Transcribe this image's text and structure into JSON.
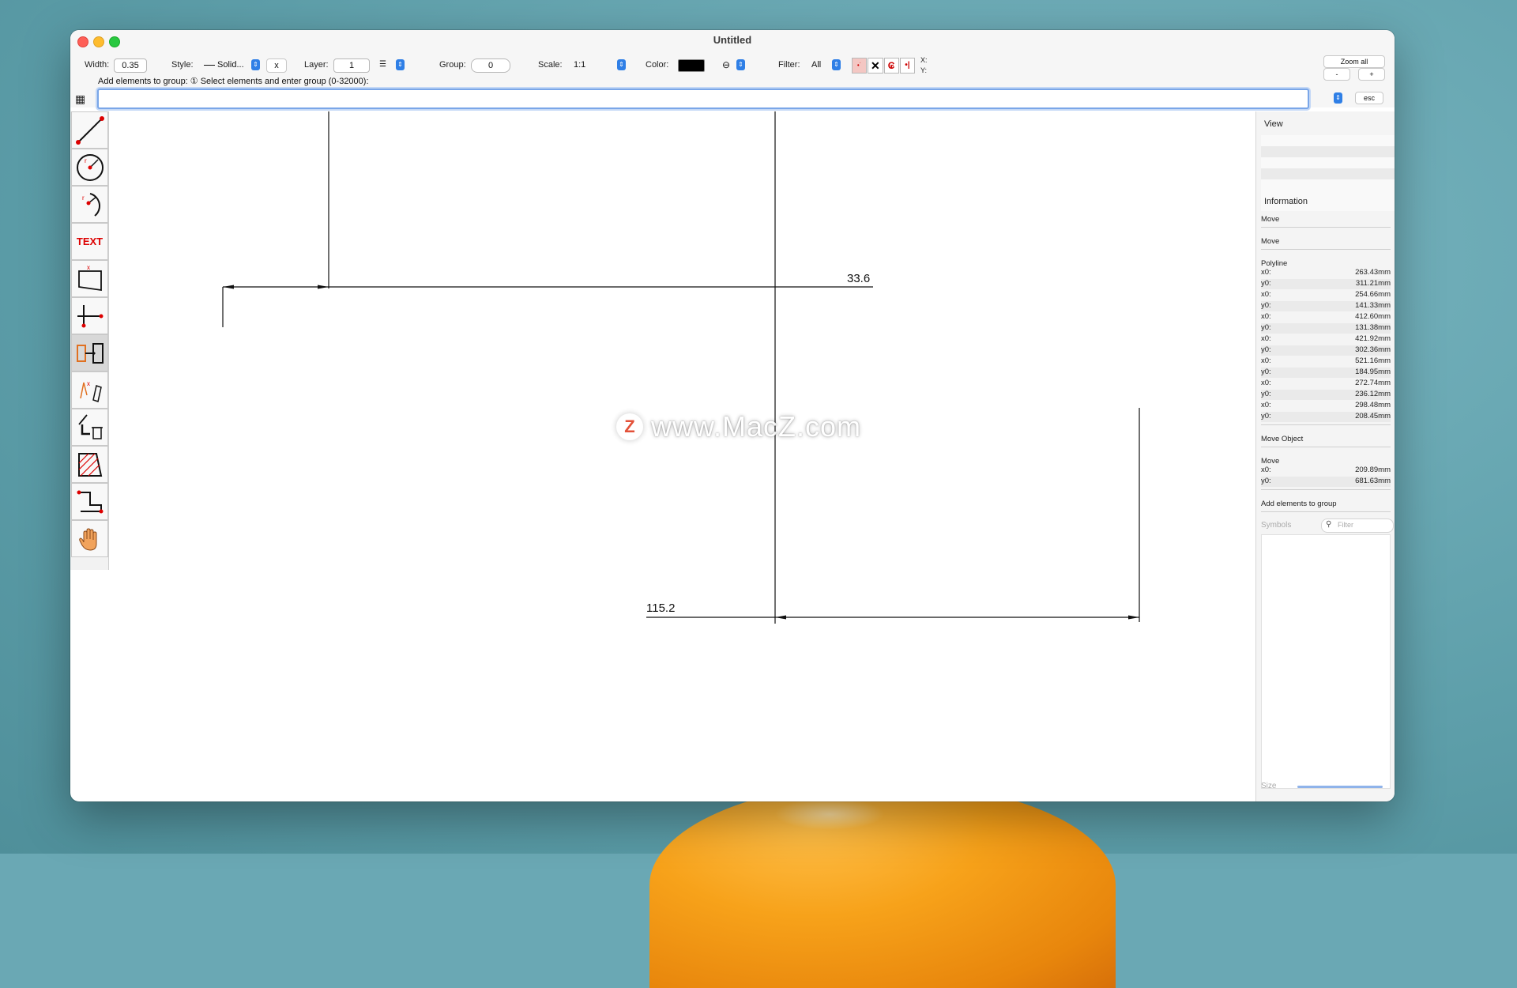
{
  "window": {
    "title": "Untitled"
  },
  "toolbar": {
    "width_label": "Width:",
    "width_value": "0.35",
    "style_label": "Style:",
    "style_value": "Solid...",
    "style_x": "x",
    "layer_label": "Layer:",
    "layer_value": "1",
    "group_label": "Group:",
    "group_value": "0",
    "scale_label": "Scale:",
    "scale_value": "1:1",
    "color_label": "Color:",
    "color_value": "#000000",
    "filter_label": "Filter:",
    "filter_value": "All",
    "coord_x": "X:",
    "coord_y": "Y:",
    "zoom_all": "Zoom all",
    "zoom_minus": "-",
    "zoom_plus": "+",
    "esc": "esc"
  },
  "hint": "Add elements to group: ① Select elements and enter group (0-32000):",
  "command_input": {
    "value": ""
  },
  "tools": [
    {
      "name": "line-tool",
      "icon": "line-icon"
    },
    {
      "name": "circle-tool",
      "icon": "circle-radius-icon"
    },
    {
      "name": "arc-tool",
      "icon": "arc-icon"
    },
    {
      "name": "text-tool",
      "icon": "text-icon",
      "label": "TEXT"
    },
    {
      "name": "dimension-tool",
      "icon": "dimension-icon"
    },
    {
      "name": "axis-tool",
      "icon": "axis-icon"
    },
    {
      "name": "move-tool",
      "icon": "move-copy-icon"
    },
    {
      "name": "transform-tool",
      "icon": "transform-icon"
    },
    {
      "name": "delete-tool",
      "icon": "trash-icon"
    },
    {
      "name": "hatch-tool",
      "icon": "hatch-icon"
    },
    {
      "name": "polyline-tool",
      "icon": "polyline-icon"
    },
    {
      "name": "pan-tool",
      "icon": "hand-icon"
    }
  ],
  "drawing": {
    "dim1": "33.6",
    "dim2": "115.2"
  },
  "watermark": {
    "letter": "Z",
    "text": "www.MacZ.com"
  },
  "panel": {
    "view_title": "View",
    "info_title": "Information",
    "entries": [
      {
        "head": "Move"
      },
      {
        "head": "Move"
      },
      {
        "head": "Polyline",
        "rows": [
          {
            "k": "x0:",
            "v": "263.43mm"
          },
          {
            "k": "y0:",
            "v": "311.21mm"
          },
          {
            "k": "x0:",
            "v": "254.66mm"
          },
          {
            "k": "y0:",
            "v": "141.33mm"
          },
          {
            "k": "x0:",
            "v": "412.60mm"
          },
          {
            "k": "y0:",
            "v": "131.38mm"
          },
          {
            "k": "x0:",
            "v": "421.92mm"
          },
          {
            "k": "y0:",
            "v": "302.36mm"
          },
          {
            "k": "x0:",
            "v": "521.16mm"
          },
          {
            "k": "y0:",
            "v": "184.95mm"
          },
          {
            "k": "x0:",
            "v": "272.74mm"
          },
          {
            "k": "y0:",
            "v": "236.12mm"
          },
          {
            "k": "x0:",
            "v": "298.48mm"
          },
          {
            "k": "y0:",
            "v": "208.45mm"
          }
        ]
      },
      {
        "head": "Move Object"
      },
      {
        "head": "Move",
        "rows": [
          {
            "k": "x0:",
            "v": "209.89mm"
          },
          {
            "k": "y0:",
            "v": "681.63mm"
          }
        ]
      },
      {
        "head": "Add elements to group"
      }
    ],
    "symbols_label": "Symbols",
    "filter_placeholder": "Filter",
    "size_label": "Size"
  }
}
